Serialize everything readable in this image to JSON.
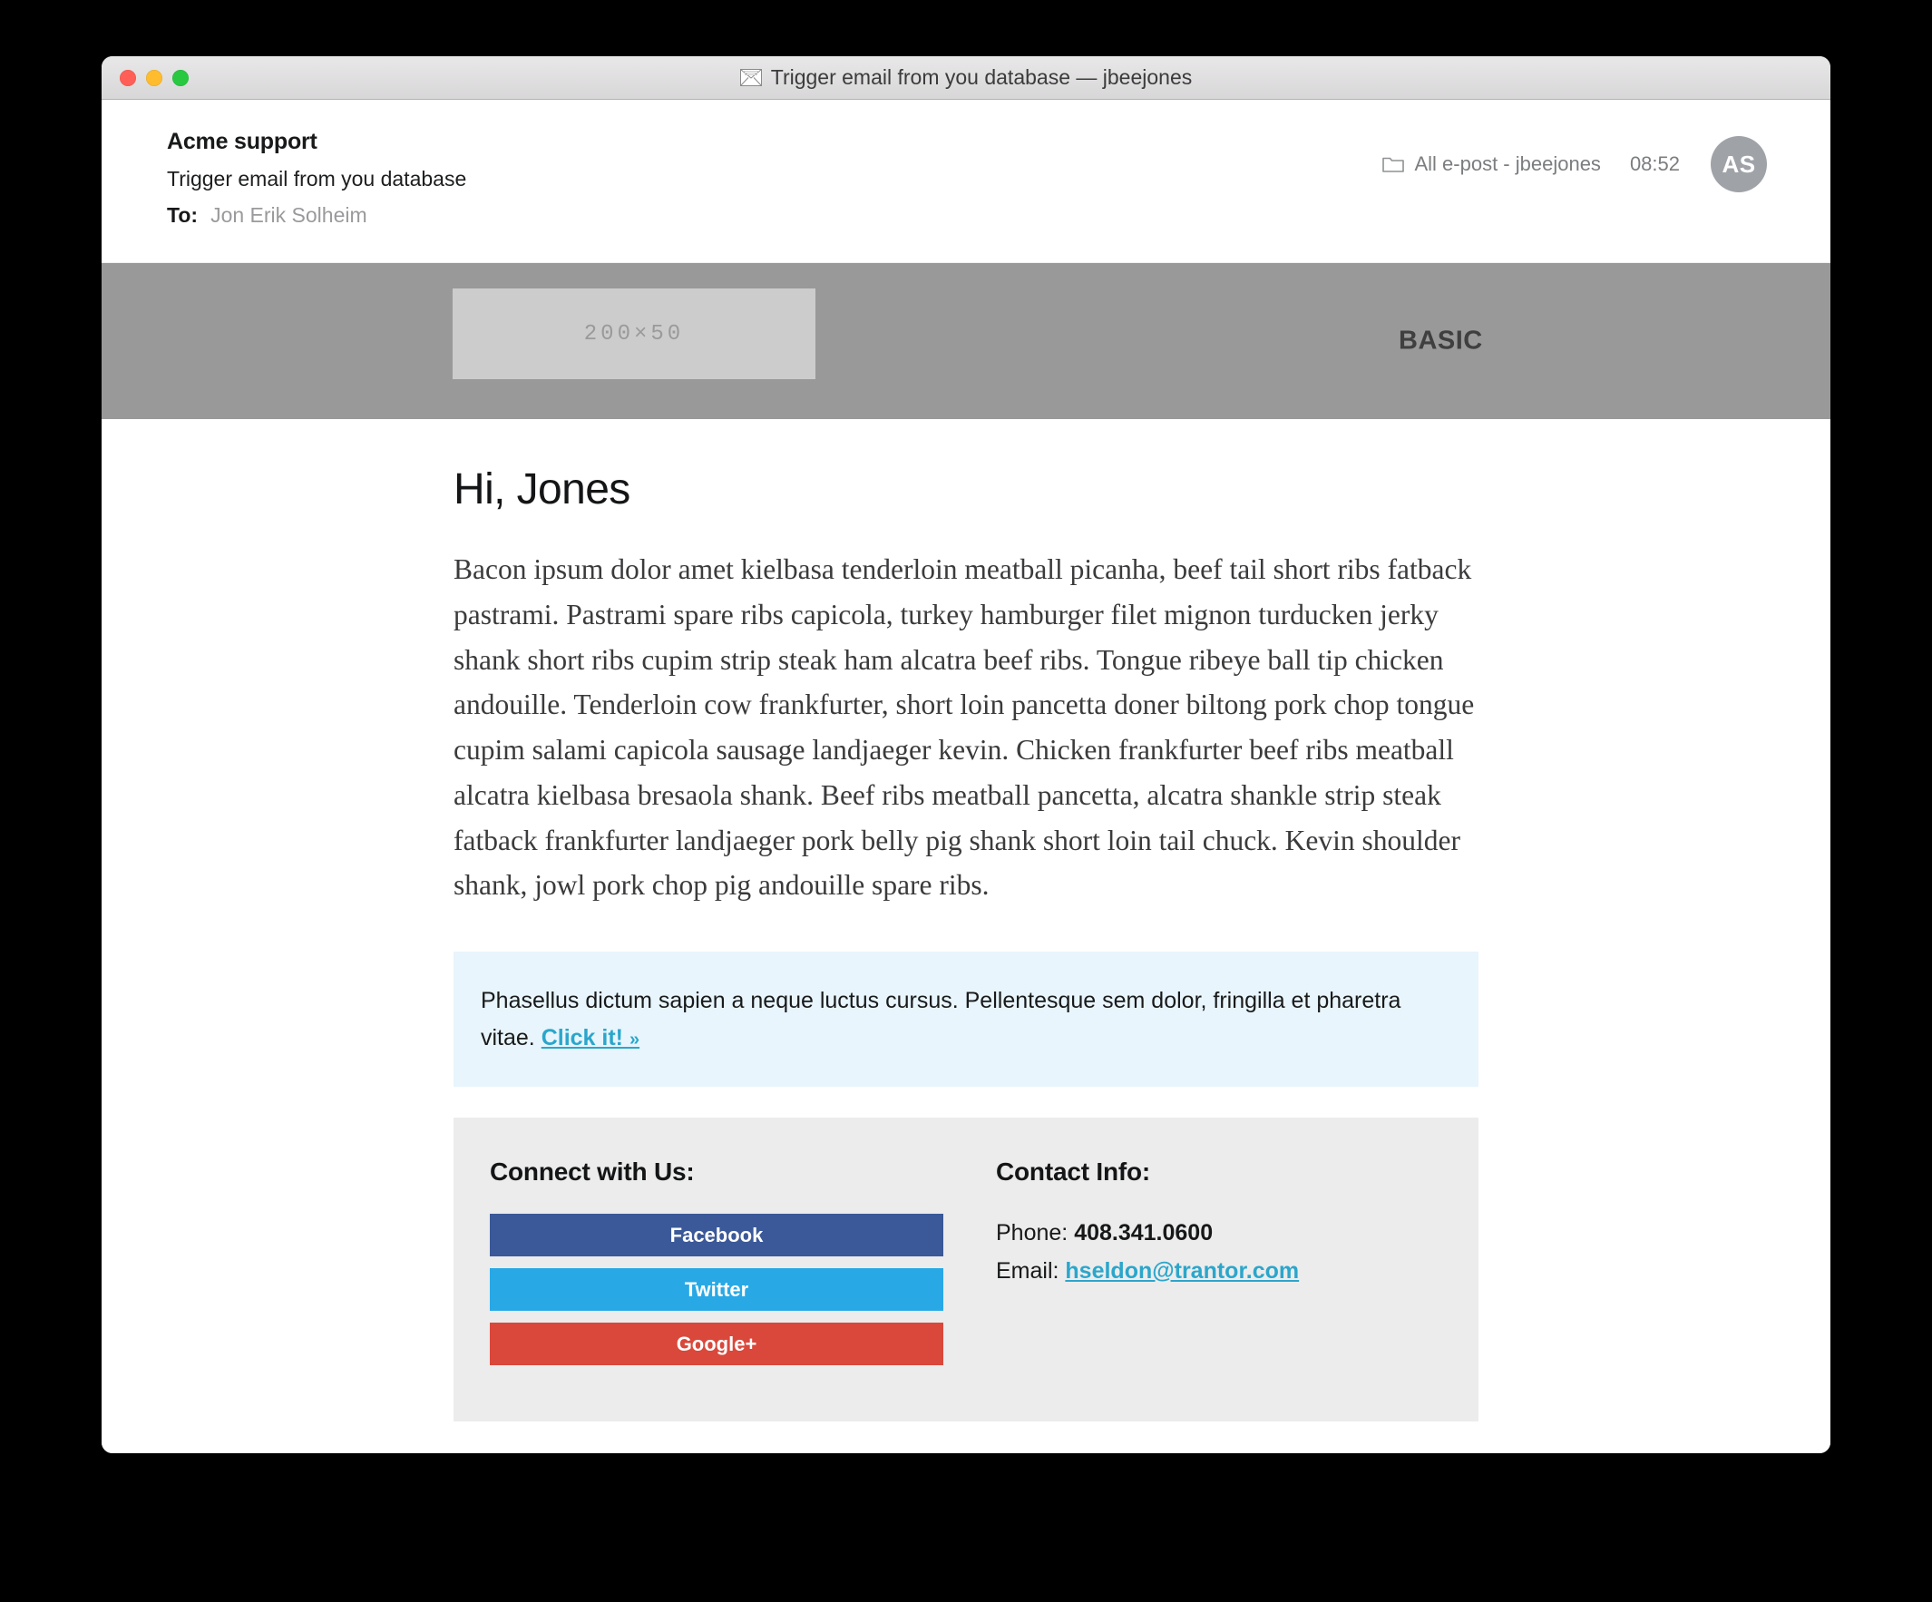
{
  "window": {
    "title": "Trigger email from you database — jbeejones",
    "title_icon": "envelope-icon",
    "traffic_lights": [
      "close",
      "minimize",
      "zoom"
    ]
  },
  "mail_header": {
    "sender": "Acme support",
    "subject": "Trigger email from you database",
    "to_label": "To:",
    "to_value": "Jon Erik Solheim",
    "folder_icon": "folder-icon",
    "folder": "All e-post - jbeejones",
    "time": "08:52",
    "avatar_initials": "AS"
  },
  "banner": {
    "logo_placeholder": "200×50",
    "tag": "BASIC",
    "bg_color": "#999999",
    "logo_bg_color": "#cccccc"
  },
  "email": {
    "greeting": "Hi, Jones",
    "paragraph": "Bacon ipsum dolor amet kielbasa tenderloin meatball picanha, beef tail short ribs fatback pastrami. Pastrami spare ribs capicola, turkey hamburger filet mignon turducken jerky shank short ribs cupim strip steak ham alcatra beef ribs. Tongue ribeye ball tip chicken andouille. Tenderloin cow frankfurter, short loin pancetta doner biltong pork chop tongue cupim salami capicola sausage landjaeger kevin. Chicken frankfurter beef ribs meatball alcatra kielbasa bresaola shank. Beef ribs meatball pancetta, alcatra shankle strip steak fatback frankfurter landjaeger pork belly pig shank short loin tail chuck. Kevin shoulder shank, jowl pork chop pig andouille spare ribs.",
    "callout_text": "Phasellus dictum sapien a neque luctus cursus. Pellentesque sem dolor, fringilla et pharetra vitae. ",
    "callout_link": "Click it!",
    "callout_link_chevron": "»",
    "callout_bg_color": "#e8f5fc",
    "link_color": "#2ba6cb"
  },
  "footer": {
    "bg_color": "#ececec",
    "connect_heading": "Connect with Us:",
    "social_buttons": [
      {
        "label": "Facebook",
        "color": "#3b5998"
      },
      {
        "label": "Twitter",
        "color": "#28a9e5"
      },
      {
        "label": "Google+",
        "color": "#d9483b"
      }
    ],
    "contact_heading": "Contact Info:",
    "phone_label": "Phone: ",
    "phone_value": "408.341.0600",
    "email_label": "Email: ",
    "email_value": "hseldon@trantor.com"
  }
}
